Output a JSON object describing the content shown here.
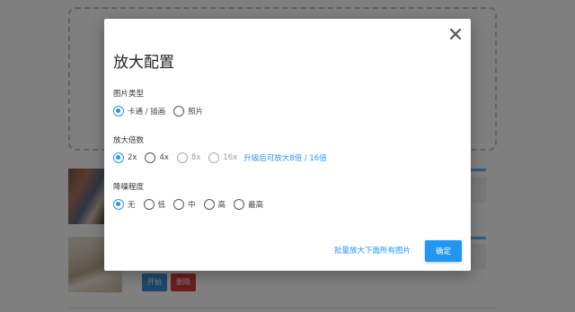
{
  "background": {
    "actions": {
      "start_label": "开始",
      "delete_label": "删除"
    }
  },
  "dialog": {
    "title": "放大配置",
    "image_type": {
      "label": "图片类型",
      "options": [
        "卡通 / 插画",
        "照片"
      ],
      "selected": "卡通 / 插画"
    },
    "scale": {
      "label": "放大倍数",
      "options": [
        "2x",
        "4x",
        "8x",
        "16x"
      ],
      "selected": "2x",
      "disabled": [
        "8x",
        "16x"
      ],
      "upgrade_text": "升级后可放大8倍 / 16倍"
    },
    "denoise": {
      "label": "降噪程度",
      "options": [
        "无",
        "低",
        "中",
        "高",
        "最高"
      ],
      "selected": "无"
    },
    "batch_link": "批量放大下面所有图片",
    "confirm_label": "确定"
  },
  "colors": {
    "accent": "#2196f3",
    "danger": "#d63a3a"
  }
}
